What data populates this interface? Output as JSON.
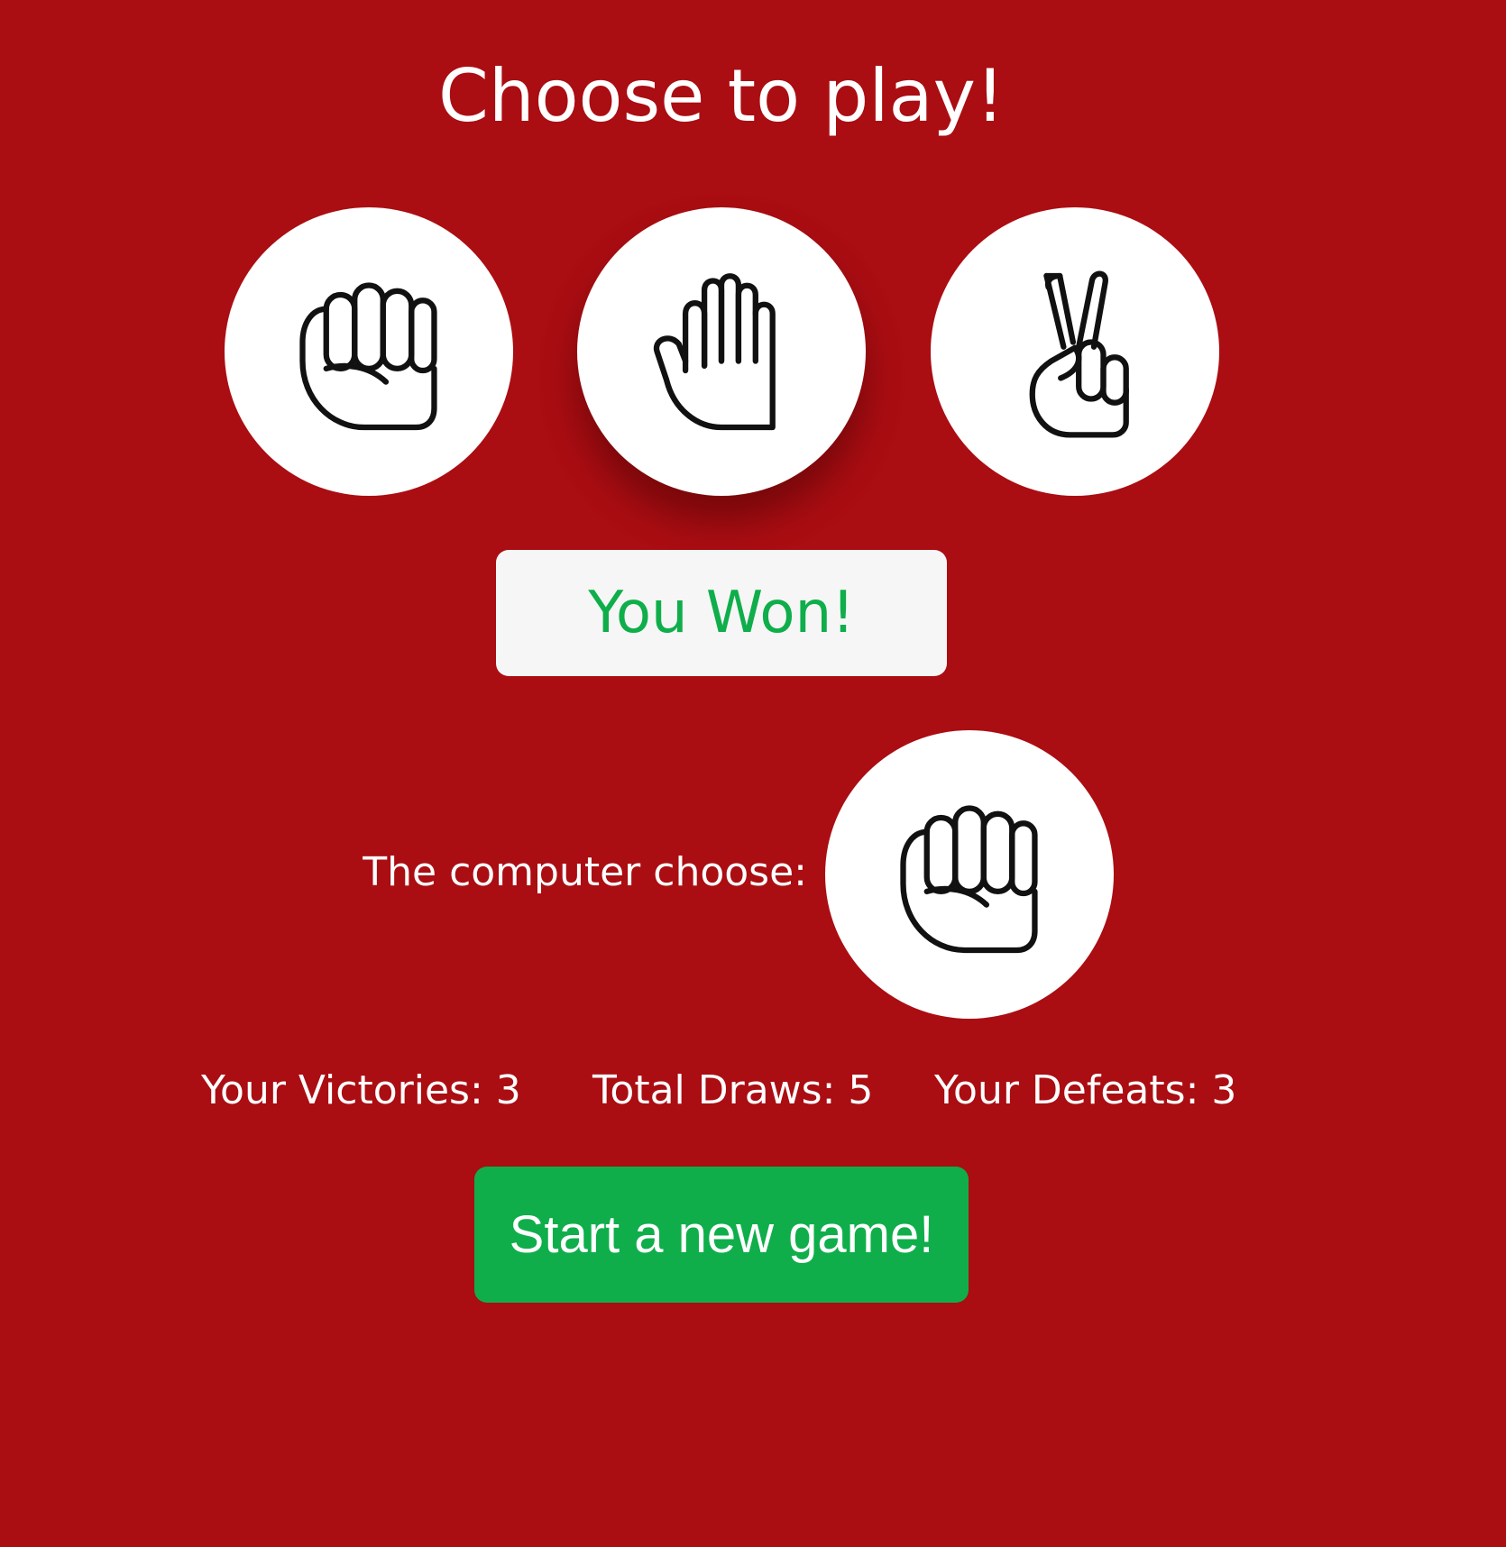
{
  "title": "Choose to play!",
  "choices": [
    {
      "id": "rock",
      "icon": "rock-fist-icon",
      "selected": false
    },
    {
      "id": "paper",
      "icon": "paper-hand-icon",
      "selected": true
    },
    {
      "id": "scissors",
      "icon": "scissors-peace-icon",
      "selected": false
    }
  ],
  "result": {
    "text": "You Won!",
    "color": "#0fae4b"
  },
  "computer": {
    "label": "The computer choose:",
    "choice_icon": "rock-fist-icon"
  },
  "stats": {
    "victories": "Your Victories: 3",
    "draws": "Total Draws: 5",
    "defeats": "Your Defeats: 3"
  },
  "new_game_button": "Start a new game!",
  "colors": {
    "background": "#aa0d12",
    "accent": "#0fae4b",
    "result_box": "#f6f6f6"
  }
}
